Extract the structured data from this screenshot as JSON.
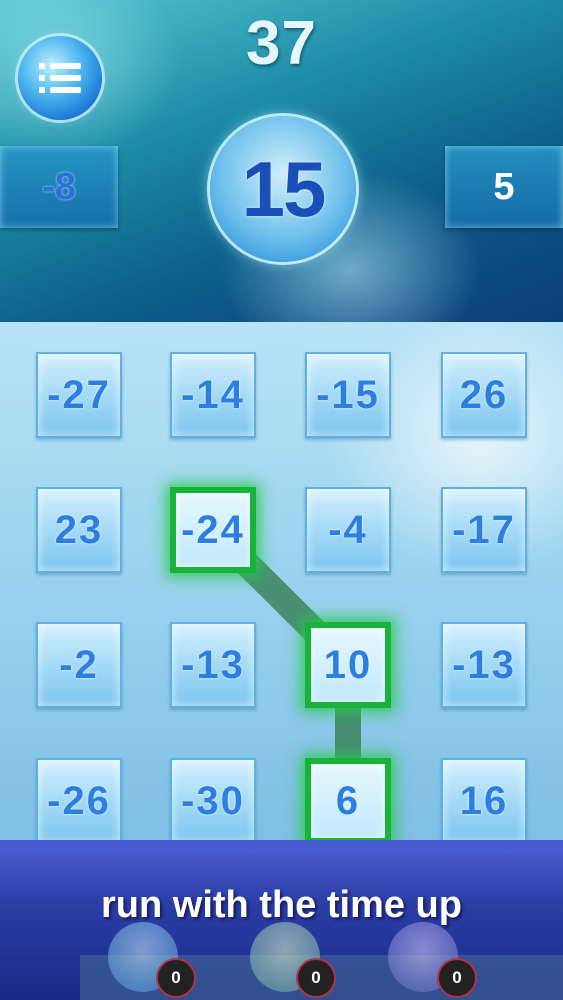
{
  "header": {
    "timer": "37",
    "left_value": "-8",
    "target": "15",
    "right_value": "5"
  },
  "grid": [
    [
      "-27",
      "-14",
      "-15",
      "26"
    ],
    [
      "23",
      "-24",
      "-4",
      "-17"
    ],
    [
      "-2",
      "-13",
      "10",
      "-13"
    ],
    [
      "-26",
      "-30",
      "6",
      "16"
    ]
  ],
  "selected_cells": [
    [
      1,
      1
    ],
    [
      2,
      2
    ],
    [
      3,
      2
    ]
  ],
  "banner": {
    "text": "run with the time up"
  },
  "powerups": [
    {
      "icon": "clock-powerup-icon",
      "count": "0"
    },
    {
      "icon": "bubble-powerup-icon",
      "count": "0"
    },
    {
      "icon": "gear-powerup-icon",
      "count": "0"
    }
  ],
  "colors": {
    "selected": "#18b43a",
    "tile_text": "#2c7fe0",
    "banner": "#2b3ea6"
  }
}
